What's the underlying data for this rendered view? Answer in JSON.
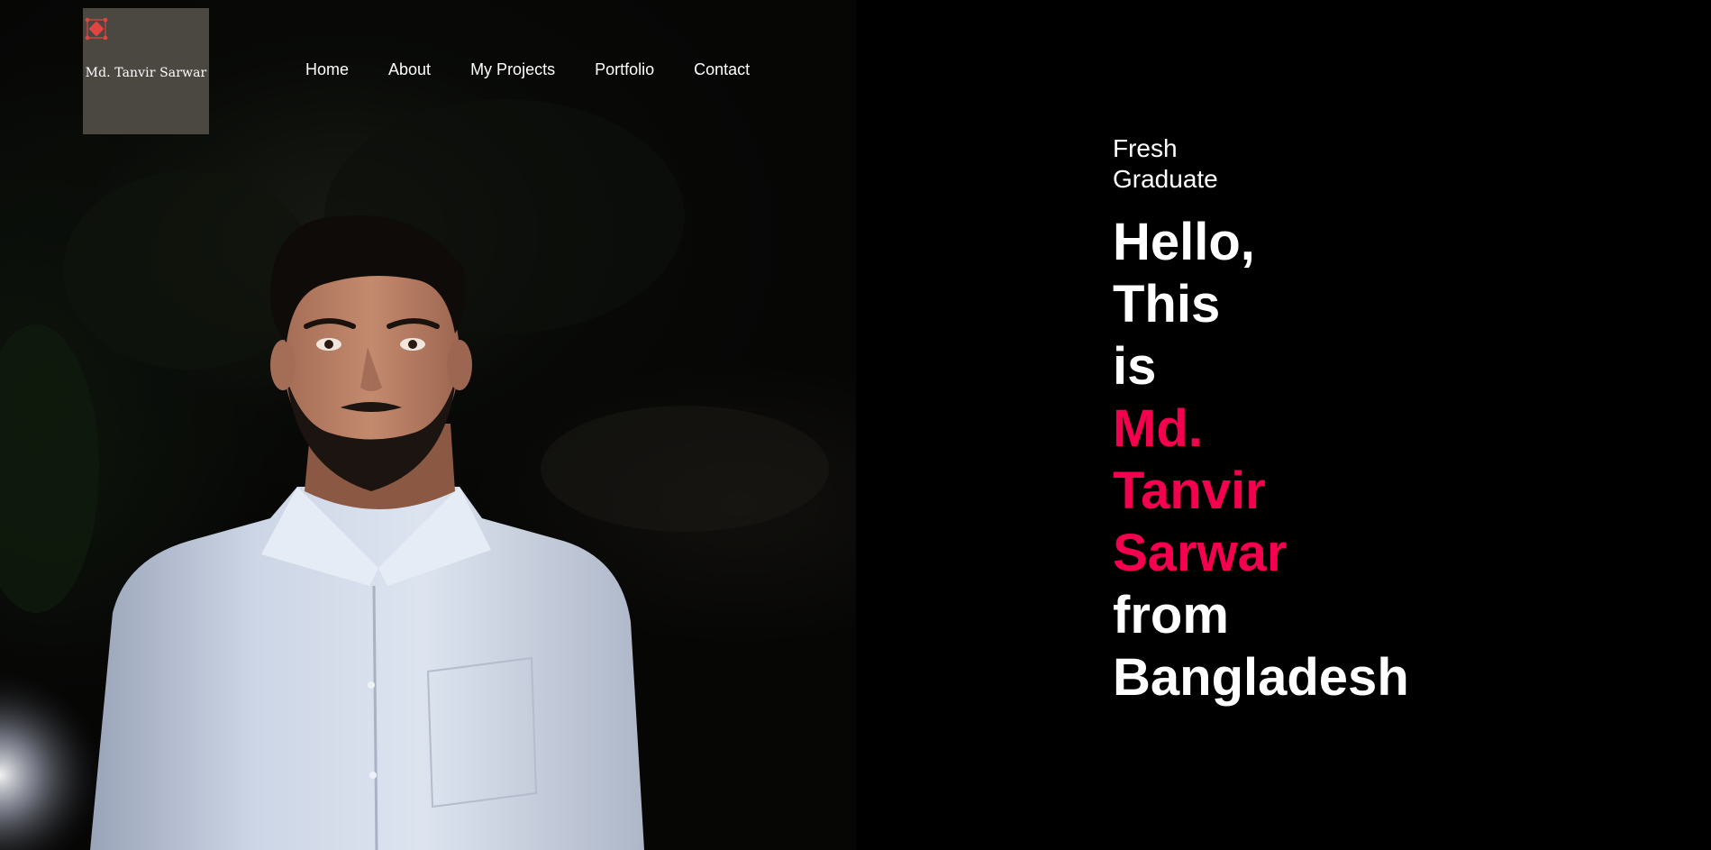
{
  "logo": {
    "text": "Md. Tanvir Sarwar",
    "mark_icon": "diamond-network-icon",
    "background": "#4b4741",
    "mark_color": "#e0463f"
  },
  "nav": {
    "items": [
      "Home",
      "About",
      "My Projects",
      "Portfolio",
      "Contact"
    ]
  },
  "hero": {
    "subtitle_lines": [
      "Fresh",
      "Graduate"
    ],
    "headline_lines": [
      "Hello,",
      "This",
      "is"
    ],
    "name_lines": [
      "Md.",
      "Tanvir",
      "Sarwar"
    ],
    "closing_lines": [
      "from",
      "Bangladesh"
    ],
    "accent_color": "#f5004f"
  },
  "photo": {
    "description_icon": "portrait-photo"
  }
}
